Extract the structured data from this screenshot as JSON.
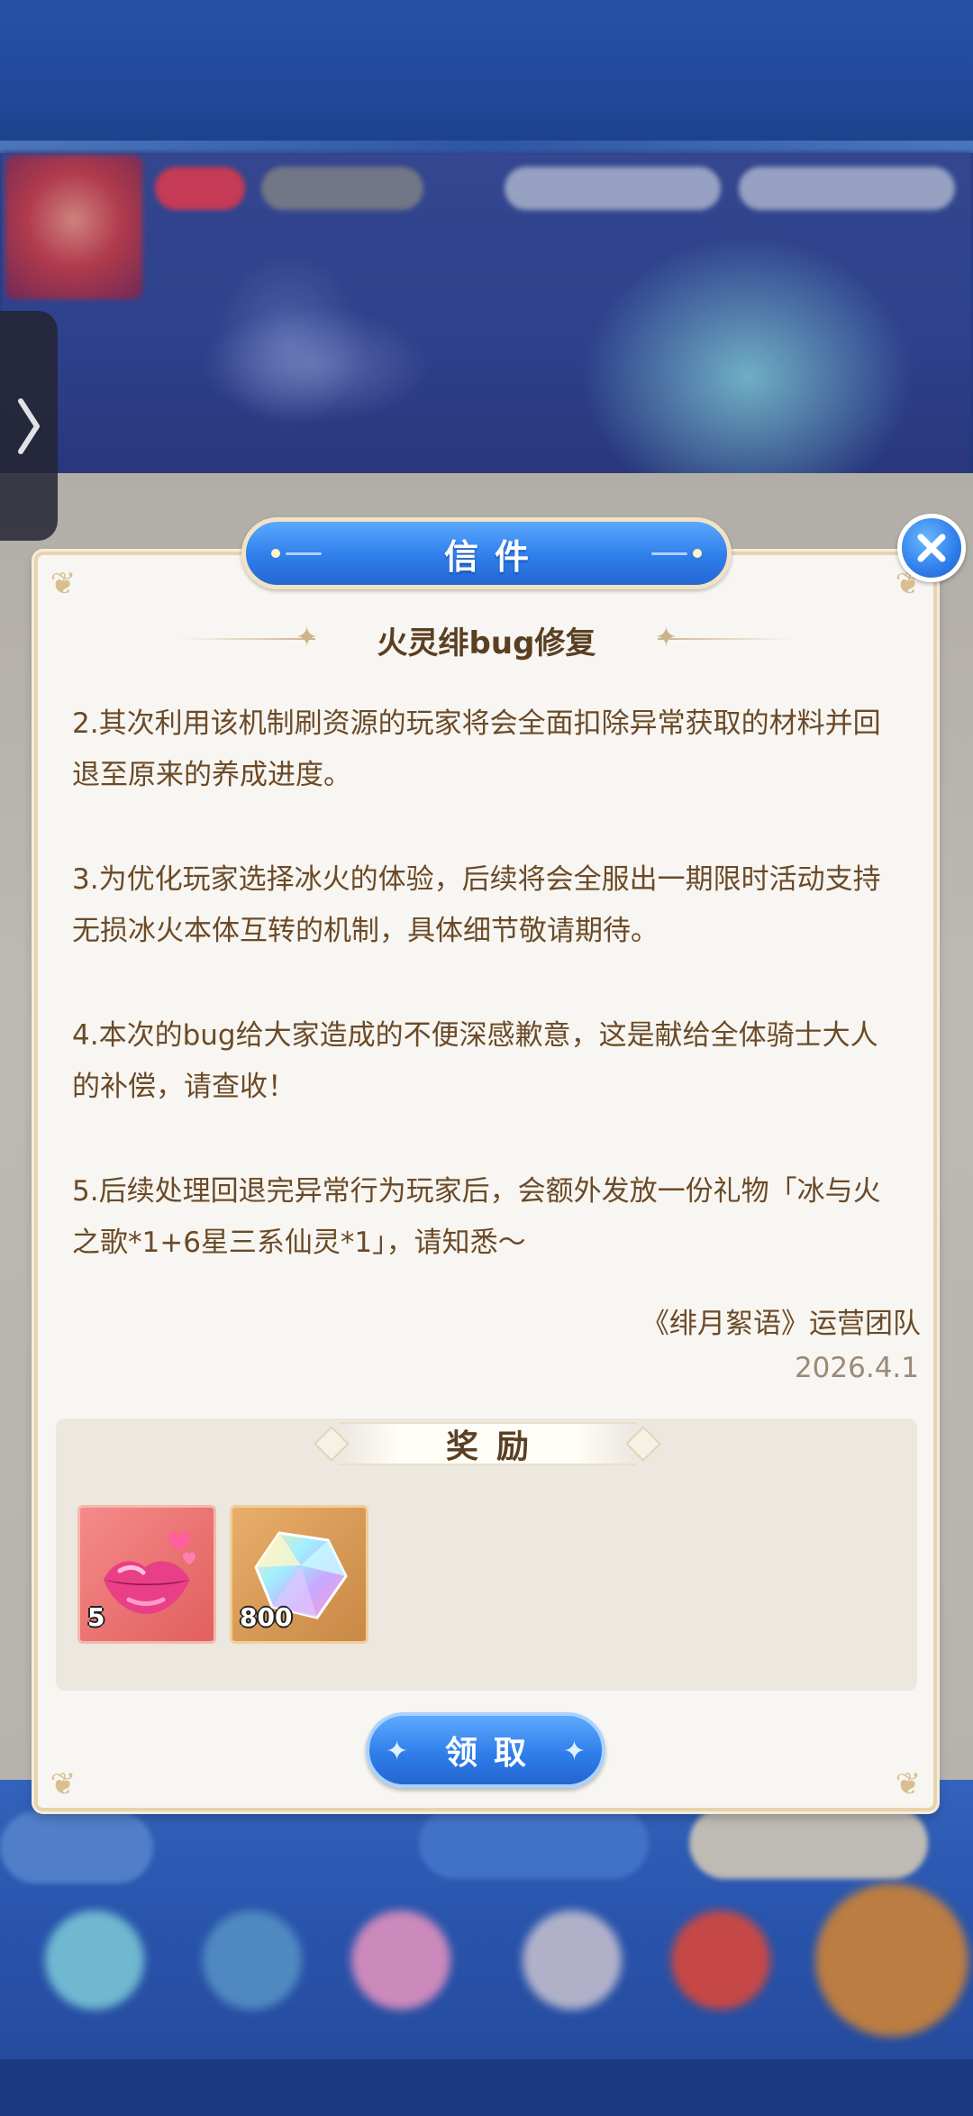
{
  "dialog": {
    "header_title": "信件",
    "mail_title": "火灵绯bug修复",
    "paragraphs": [
      "2.其次利用该机制刷资源的玩家将会全面扣除异常获取的材料并回退至原来的养成进度。",
      "3.为优化玩家选择冰火的体验，后续将会全服出一期限时活动支持无损冰火本体互转的机制，具体细节敬请期待。",
      "4.本次的bug给大家造成的不便深感歉意，这是献给全体骑士大人的补偿，请查收！",
      "5.后续处理回退完异常行为玩家后，会额外发放一份礼物「冰与火之歌*1+6星三系仙灵*1」，请知悉～"
    ],
    "signature": "《绯月絮语》运营团队",
    "date": "2026.4.1",
    "rewards_title": "奖励",
    "rewards": [
      {
        "icon": "lips-icon",
        "count": "5"
      },
      {
        "icon": "crystal-icon",
        "count": "800"
      }
    ],
    "claim_label": "领取",
    "close_icon": "close-icon"
  },
  "colors": {
    "accent_blue": "#2f7eea",
    "panel_bg": "#f8f6f2",
    "text_brown": "#6b4a27",
    "date_gray": "#9a8a78"
  }
}
